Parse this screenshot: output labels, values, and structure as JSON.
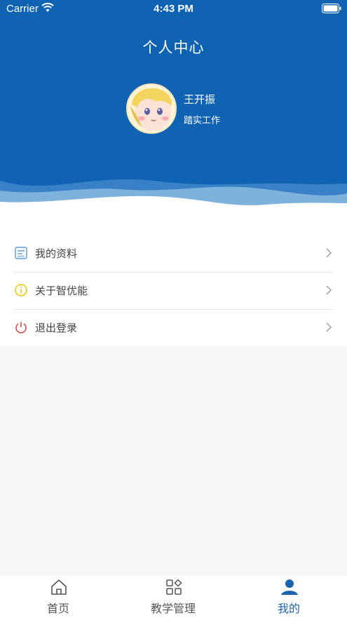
{
  "status_bar": {
    "carrier": "Carrier",
    "time": "4:43 PM"
  },
  "header": {
    "title": "个人中心"
  },
  "profile": {
    "name": "王开振",
    "motto": "踏实工作"
  },
  "menu": {
    "items": [
      {
        "label": "我的资料",
        "icon": "profile-card-icon"
      },
      {
        "label": "关于智优能",
        "icon": "info-icon"
      },
      {
        "label": "退出登录",
        "icon": "power-icon"
      }
    ]
  },
  "tabbar": {
    "items": [
      {
        "label": "首页",
        "icon": "home-icon"
      },
      {
        "label": "教学管理",
        "icon": "grid-icon"
      },
      {
        "label": "我的",
        "icon": "user-icon",
        "active": true
      }
    ]
  },
  "colors": {
    "header_blue": "#0f63b2",
    "active_tab": "#1b64b0",
    "info_yellow": "#f2c200",
    "power_red": "#e34b4b"
  }
}
